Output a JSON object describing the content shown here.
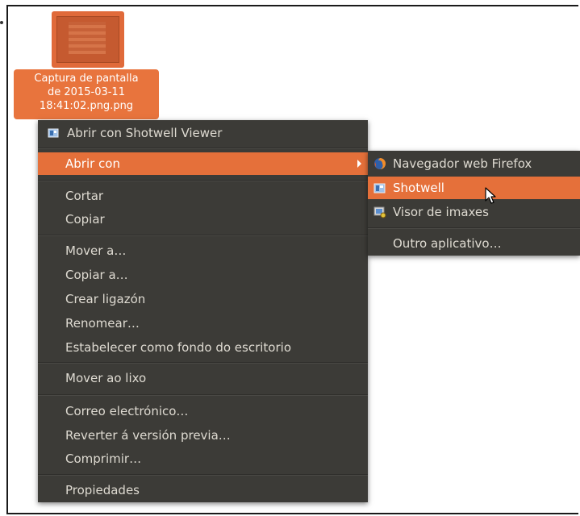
{
  "desktop_file": {
    "name_lines": [
      "Captura de pantalla",
      "de 2015-03-11",
      "18:41:02.png.png"
    ],
    "icon": "image-file-icon"
  },
  "context_menu": {
    "open_with_default": {
      "label": "Abrir con Shotwell Viewer",
      "icon": "shotwell-icon"
    },
    "open_with": {
      "label": "Abrir con",
      "icon": "submenu-arrow-icon"
    },
    "items": [
      {
        "label": "Cortar"
      },
      {
        "label": "Copiar"
      },
      {
        "label": "Mover a…"
      },
      {
        "label": "Copiar a…"
      },
      {
        "label": "Crear ligazón"
      },
      {
        "label": "Renomear…"
      },
      {
        "label": "Estabelecer como fondo do escritorio"
      },
      {
        "label": "Mover ao lixo"
      },
      {
        "label": "Correo electrónico…"
      },
      {
        "label": "Reverter á versión previa…"
      },
      {
        "label": "Comprimir…"
      },
      {
        "label": "Propiedades"
      }
    ]
  },
  "open_with_submenu": {
    "items": [
      {
        "label": "Navegador web Firefox",
        "icon": "firefox-icon"
      },
      {
        "label": "Shotwell",
        "icon": "shotwell-icon"
      },
      {
        "label": "Visor de imaxes",
        "icon": "image-viewer-icon"
      },
      {
        "label": "Outro aplicativo…"
      }
    ]
  },
  "colors": {
    "menu_bg": "#3c3b37",
    "menu_text": "#dfdbd2",
    "highlight": "#e5703a",
    "selection_label": "#e8743d"
  }
}
